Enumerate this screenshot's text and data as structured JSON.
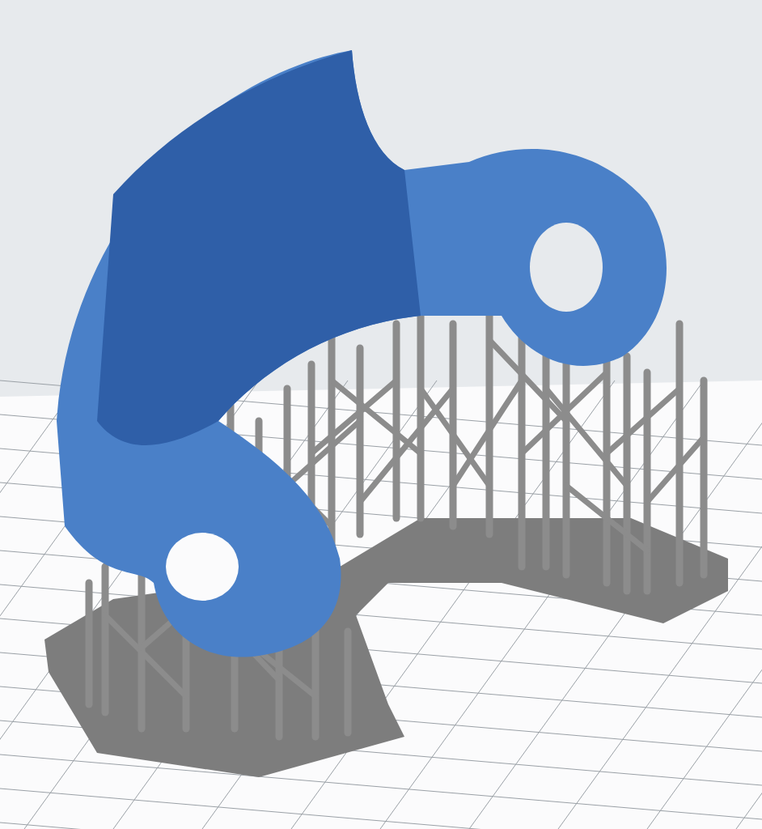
{
  "viewport": {
    "kind": "print-preview",
    "grid": true
  }
}
